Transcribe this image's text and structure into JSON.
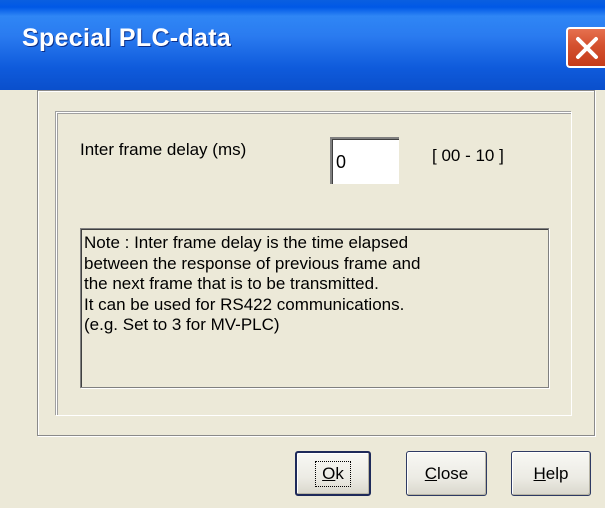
{
  "window": {
    "title": "Special PLC-data"
  },
  "settings": {
    "delay_label": "Inter frame delay (ms)",
    "delay_value": "0",
    "range": "[ 00 - 10 ]"
  },
  "note": {
    "lines": [
      "Note : Inter frame delay is the time elapsed",
      "between the response of previous frame and",
      "the next frame that is to be transmitted.",
      "It can be used for RS422 communications.",
      "(e.g. Set to 3 for MV-PLC)"
    ]
  },
  "buttons": {
    "ok": {
      "accel": "O",
      "rest": "k"
    },
    "close": {
      "accel": "C",
      "rest": "lose"
    },
    "help": {
      "accel": "H",
      "rest": "elp"
    }
  },
  "icons": {
    "close": "close-icon"
  },
  "colors": {
    "titlebar": "#0a5fe0",
    "close_button": "#d4512f",
    "dialog_bg": "#ece9d8"
  }
}
